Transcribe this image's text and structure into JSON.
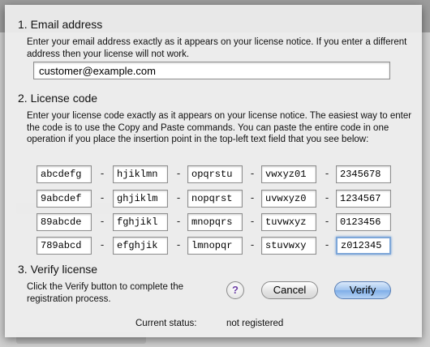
{
  "email_section": {
    "heading": "1. Email address",
    "description": "Enter your email address exactly as it appears on your license notice. If you enter a different address then your license will not work.",
    "email_value": "customer@example.com"
  },
  "license_section": {
    "heading": "2. License code",
    "description": "Enter your license code exactly as it appears on your license notice. The easiest way to enter the code is to use the Copy and Paste commands. You can paste the entire code in one operation if you place the insertion point in the top-left text field that you see below:",
    "separator": "-",
    "rows": [
      [
        "abcdefg",
        "hjiklmn",
        "opqrstu",
        "vwxyz01",
        "2345678"
      ],
      [
        "9abcdef",
        "ghjiklm",
        "nopqrst",
        "uvwxyz0",
        "1234567"
      ],
      [
        "89abcde",
        "fghjikl",
        "mnopqrs",
        "tuvwxyz",
        "0123456"
      ],
      [
        "789abcd",
        "efghjik",
        "lmnopqr",
        "stuvwxy",
        "z012345"
      ]
    ]
  },
  "verify_section": {
    "heading": "3. Verify license",
    "description": "Click the Verify button to complete the registration process.",
    "help_label": "?",
    "cancel_label": "Cancel",
    "verify_label": "Verify"
  },
  "status": {
    "label": "Current status:",
    "value": "not registered"
  },
  "colors": {
    "default_button": "#7eaee8",
    "help_glyph": "#6d3fa6",
    "focus_ring": "#7ea7d8"
  },
  "icons": {
    "help": "help-icon"
  }
}
